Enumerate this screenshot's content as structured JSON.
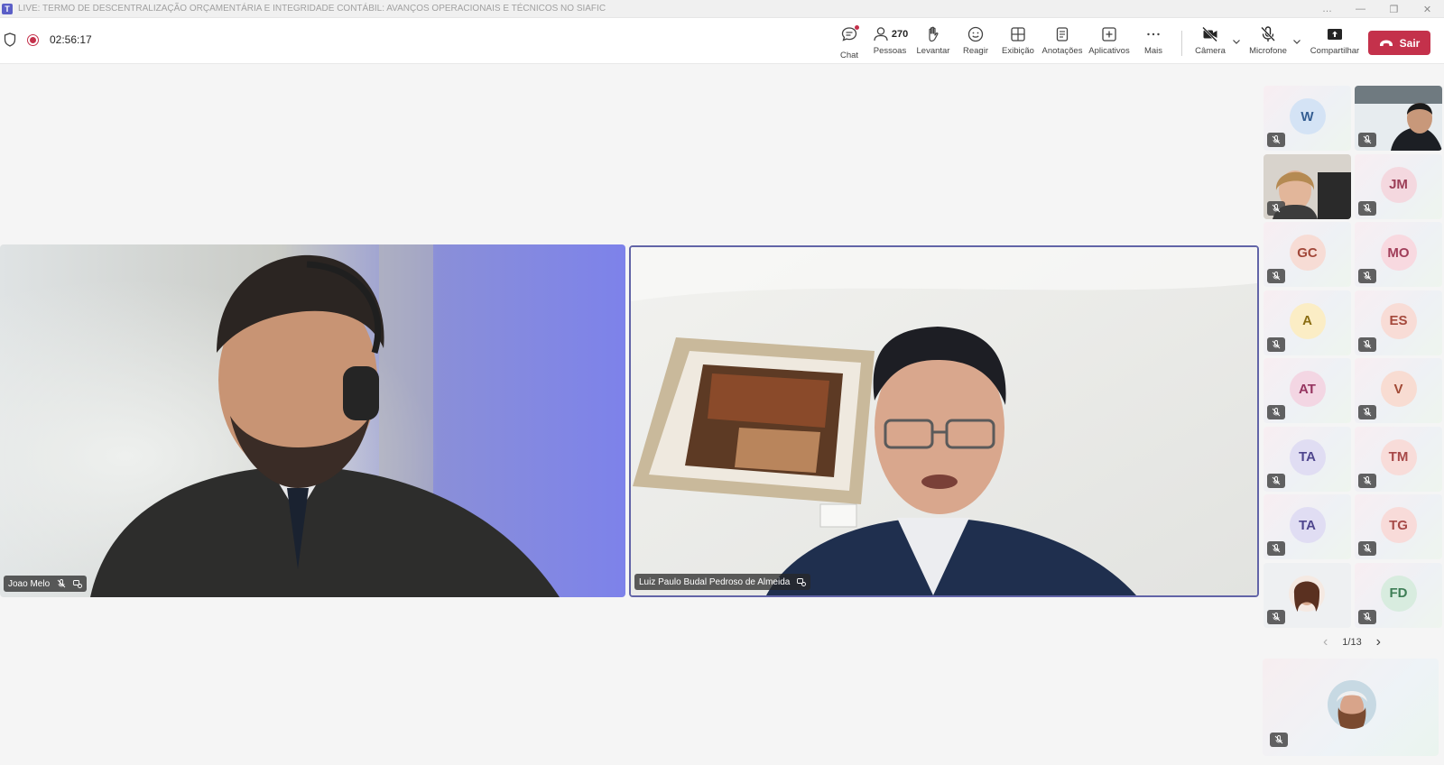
{
  "window": {
    "title": "LIVE: TERMO DE DESCENTRALIZAÇÃO ORÇAMENTÁRIA E INTEGRIDADE CONTÁBIL: AVANÇOS OPERACIONAIS E TÉCNICOS NO SIAFIC",
    "app_icon": "teams-icon",
    "controls": [
      "…",
      "—",
      "❐",
      "✕"
    ]
  },
  "toolbar": {
    "timer": "02:56:17",
    "chat_label": "Chat",
    "people_count": "270",
    "people_label": "Pessoas",
    "raise_label": "Levantar",
    "react_label": "Reagir",
    "view_label": "Exibição",
    "notes_label": "Anotações",
    "apps_label": "Aplicativos",
    "more_label": "Mais",
    "camera_label": "Câmera",
    "mic_label": "Microfone",
    "share_label": "Compartilhar",
    "leave_label": "Sair",
    "leave_color": "#c4314b",
    "accent_color": "#6264a7"
  },
  "stage": {
    "left_name": "Joao Melo",
    "right_name": "Luiz Paulo Budal Pedroso de Almeida"
  },
  "gallery": [
    {
      "initials": "W",
      "bg": "#d4e3f5",
      "fg": "#365f93"
    },
    {
      "initials": "",
      "photo": true
    },
    {
      "initials": "",
      "photo": true
    },
    {
      "initials": "JM",
      "bg": "#f4d8df",
      "fg": "#9c3e57"
    },
    {
      "initials": "GC",
      "bg": "#f7dcd5",
      "fg": "#a2483a"
    },
    {
      "initials": "MO",
      "bg": "#f8d9e0",
      "fg": "#a13e5a"
    },
    {
      "initials": "A",
      "bg": "#fbedc5",
      "fg": "#8a6d13"
    },
    {
      "initials": "ES",
      "bg": "#f8dcd6",
      "fg": "#a5493c"
    },
    {
      "initials": "AT",
      "bg": "#f3d6e3",
      "fg": "#95345f"
    },
    {
      "initials": "V",
      "bg": "#f8dcd2",
      "fg": "#a24a36"
    },
    {
      "initials": "TA",
      "bg": "#e0ddf3",
      "fg": "#4f468e"
    },
    {
      "initials": "TM",
      "bg": "#f8dcd9",
      "fg": "#a74848"
    },
    {
      "initials": "TA",
      "bg": "#e0ddf3",
      "fg": "#4f468e"
    },
    {
      "initials": "TG",
      "bg": "#f8dbd9",
      "fg": "#a64a48"
    },
    {
      "initials": "",
      "photo": true
    },
    {
      "initials": "FD",
      "bg": "#d8ecdf",
      "fg": "#3e7e56"
    }
  ],
  "pager": {
    "prev": "‹",
    "label": "1/13",
    "next": "›"
  }
}
